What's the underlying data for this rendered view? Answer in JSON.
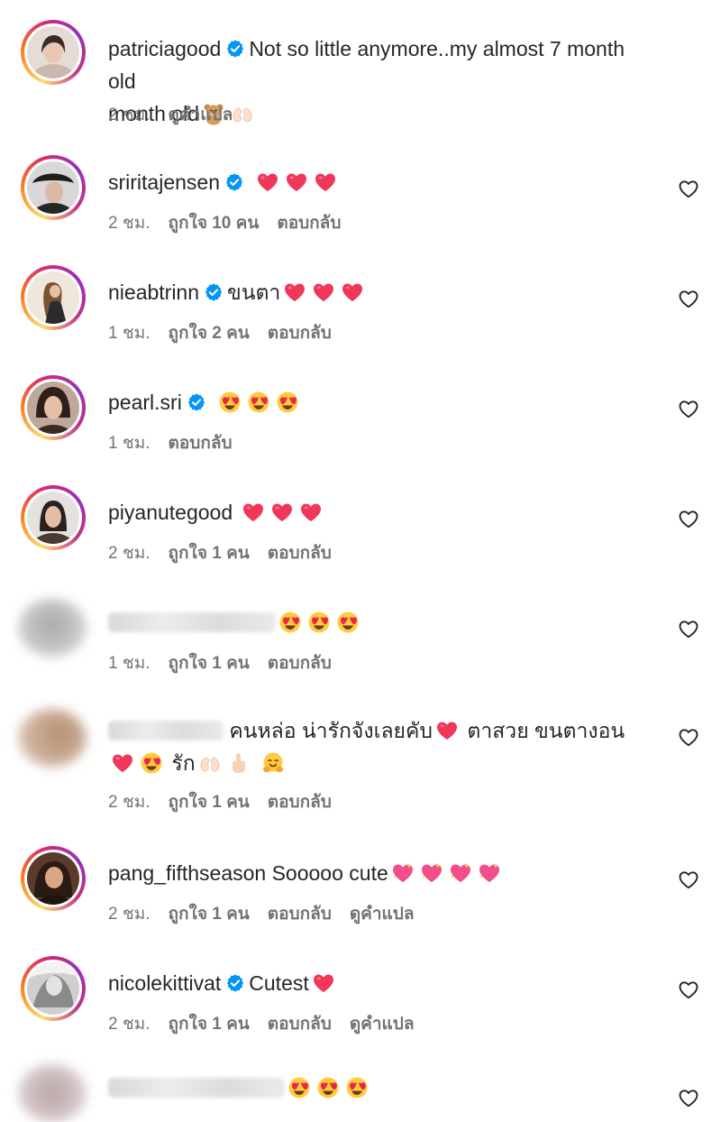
{
  "comments": [
    {
      "username": "patriciagood",
      "verified": true,
      "text": "Not so little anymore..my almost 7 month old",
      "time": "2 ชม.",
      "likes": "",
      "reply": "",
      "translate": "ดูคำแปล"
    },
    {
      "username": "sriritajensen",
      "verified": true,
      "text": "",
      "time": "2 ชม.",
      "likes": "ถูกใจ 10 คน",
      "reply": "ตอบกลับ",
      "translate": ""
    },
    {
      "username": "nieabtrinn",
      "verified": true,
      "text": "ขนตา",
      "time": "1 ชม.",
      "likes": "ถูกใจ 2 คน",
      "reply": "ตอบกลับ",
      "translate": ""
    },
    {
      "username": "pearl.sri",
      "verified": true,
      "text": "",
      "time": "1 ชม.",
      "likes": "",
      "reply": "ตอบกลับ",
      "translate": ""
    },
    {
      "username": "piyanutegood",
      "verified": false,
      "text": "",
      "time": "2 ชม.",
      "likes": "ถูกใจ 1 คน",
      "reply": "ตอบกลับ",
      "translate": ""
    },
    {
      "username": "",
      "verified": false,
      "text": "",
      "time": "1 ชม.",
      "likes": "ถูกใจ 1 คน",
      "reply": "ตอบกลับ",
      "translate": ""
    },
    {
      "username": "",
      "verified": false,
      "text": "คนหล่อ น่ารักจังเลยคับ",
      "text2": "ตาสวย ขนตางอน",
      "text3": "รัก",
      "time": "2 ชม.",
      "likes": "ถูกใจ 1 คน",
      "reply": "ตอบกลับ",
      "translate": ""
    },
    {
      "username": "pang_fifthseason",
      "verified": false,
      "text": "Sooooo cute",
      "time": "2 ชม.",
      "likes": "ถูกใจ 1 คน",
      "reply": "ตอบกลับ",
      "translate": "ดูคำแปล"
    },
    {
      "username": "nicolekittivat",
      "verified": true,
      "text": "Cutest",
      "time": "2 ชม.",
      "likes": "ถูกใจ 1 คน",
      "reply": "ตอบกลับ",
      "translate": "ดูคำแปล"
    }
  ],
  "colors": {
    "verified": "#0095f6",
    "heart": "#f0375a",
    "meta_text": "#737373"
  },
  "icons": {
    "like": "heart-outline-icon",
    "verified": "verified-badge-icon"
  }
}
